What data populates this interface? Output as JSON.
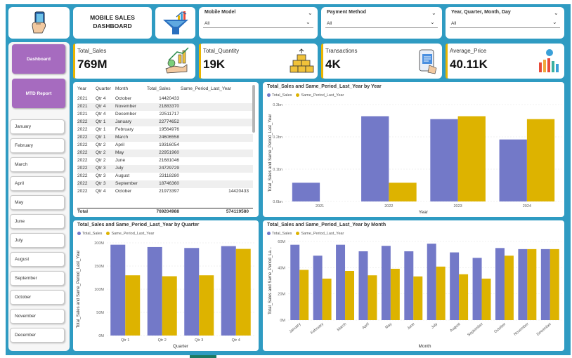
{
  "header": {
    "title_line1": "MOBILE SALES",
    "title_line2": "DASHBOARD"
  },
  "filters": [
    {
      "title": "Mobile Model",
      "value": "All"
    },
    {
      "title": "Payment Method",
      "value": "All"
    },
    {
      "title": "Year, Quarter, Month, Day",
      "value": "All"
    }
  ],
  "kpis": [
    {
      "label": "Total_Sales",
      "value": "769M",
      "icon": "money-growth-icon"
    },
    {
      "label": "Total_Quantity",
      "value": "19K",
      "icon": "boxes-icon"
    },
    {
      "label": "Transactions",
      "value": "4K",
      "icon": "receipt-phone-icon"
    },
    {
      "label": "Average_Price",
      "value": "40.11K",
      "icon": "bar-chart-icon"
    }
  ],
  "nav": {
    "dashboard": "Dashboard",
    "mtd_report": "MTD Report"
  },
  "months": [
    "January",
    "February",
    "March",
    "April",
    "May",
    "June",
    "July",
    "August",
    "September",
    "October",
    "November",
    "December"
  ],
  "table": {
    "headers": [
      "Year",
      "Quarter",
      "Month",
      "Total_Sales",
      "Same_Period_Last_Year"
    ],
    "rows": [
      [
        "2021",
        "Qtr 4",
        "October",
        "14420433",
        ""
      ],
      [
        "2021",
        "Qtr 4",
        "November",
        "21883370",
        ""
      ],
      [
        "2021",
        "Qtr 4",
        "December",
        "22511717",
        ""
      ],
      [
        "2022",
        "Qtr 1",
        "January",
        "22774652",
        ""
      ],
      [
        "2022",
        "Qtr 1",
        "February",
        "19564976",
        ""
      ],
      [
        "2022",
        "Qtr 1",
        "March",
        "24606558",
        ""
      ],
      [
        "2022",
        "Qtr 2",
        "April",
        "19316054",
        ""
      ],
      [
        "2022",
        "Qtr 2",
        "May",
        "22951960",
        ""
      ],
      [
        "2022",
        "Qtr 2",
        "June",
        "21681046",
        ""
      ],
      [
        "2022",
        "Qtr 3",
        "July",
        "24729729",
        ""
      ],
      [
        "2022",
        "Qtr 3",
        "August",
        "23118280",
        ""
      ],
      [
        "2022",
        "Qtr 3",
        "September",
        "18746360",
        ""
      ],
      [
        "2022",
        "Qtr 4",
        "October",
        "21973397",
        "14420433"
      ]
    ],
    "total": {
      "label": "Total",
      "sales": "769204988",
      "last_year": "574119580"
    }
  },
  "colors": {
    "series1": "#7379c8",
    "series2": "#ddb300",
    "teal": "#2f9bc2",
    "purple": "#a66bbf"
  },
  "chart_data": [
    {
      "type": "bar",
      "title": "Total_Sales and Same_Period_Last_Year by Year",
      "xlabel": "Year",
      "ylabel": "Total_Sales and Same_Period_Last_Year",
      "categories": [
        "2021",
        "2022",
        "2023",
        "2024"
      ],
      "yticks": [
        "0.0bn",
        "0.1bn",
        "0.2bn",
        "0.3bn"
      ],
      "ylim": [
        0,
        0.3
      ],
      "series": [
        {
          "name": "Total_Sales",
          "values": [
            0.058,
            0.264,
            0.255,
            0.192
          ]
        },
        {
          "name": "Same_Period_Last_Year",
          "values": [
            0,
            0.058,
            0.264,
            0.255
          ]
        }
      ]
    },
    {
      "type": "bar",
      "title": "Total_Sales and Same_Period_Last_Year by Quarter",
      "xlabel": "Quarter",
      "ylabel": "Total_Sales and Same_Period_Last_Year",
      "categories": [
        "Qtr 1",
        "Qtr 2",
        "Qtr 3",
        "Qtr 4"
      ],
      "yticks": [
        "0M",
        "50M",
        "100M",
        "150M",
        "200M"
      ],
      "ylim": [
        0,
        200
      ],
      "series": [
        {
          "name": "Total_Sales",
          "values": [
            196,
            191,
            189,
            193
          ]
        },
        {
          "name": "Same_Period_Last_Year",
          "values": [
            130,
            128,
            130,
            187
          ]
        }
      ]
    },
    {
      "type": "bar",
      "title": "Total_Sales and Same_Period_Last_Year by Month",
      "xlabel": "Month",
      "ylabel": "Total_Sales and Same_Period_La...",
      "categories": [
        "January",
        "February",
        "March",
        "April",
        "May",
        "June",
        "July",
        "August",
        "September",
        "October",
        "November",
        "December"
      ],
      "yticks": [
        "0M",
        "20M",
        "40M",
        "60M"
      ],
      "ylim": [
        0,
        72
      ],
      "series": [
        {
          "name": "Total_Sales",
          "values": [
            69,
            59,
            69,
            63,
            68,
            63,
            70,
            62,
            57,
            66,
            65,
            65
          ]
        },
        {
          "name": "Same_Period_Last_Year",
          "values": [
            46,
            38,
            45,
            41,
            47,
            40,
            49,
            42,
            38,
            59,
            65,
            65
          ]
        }
      ]
    }
  ]
}
